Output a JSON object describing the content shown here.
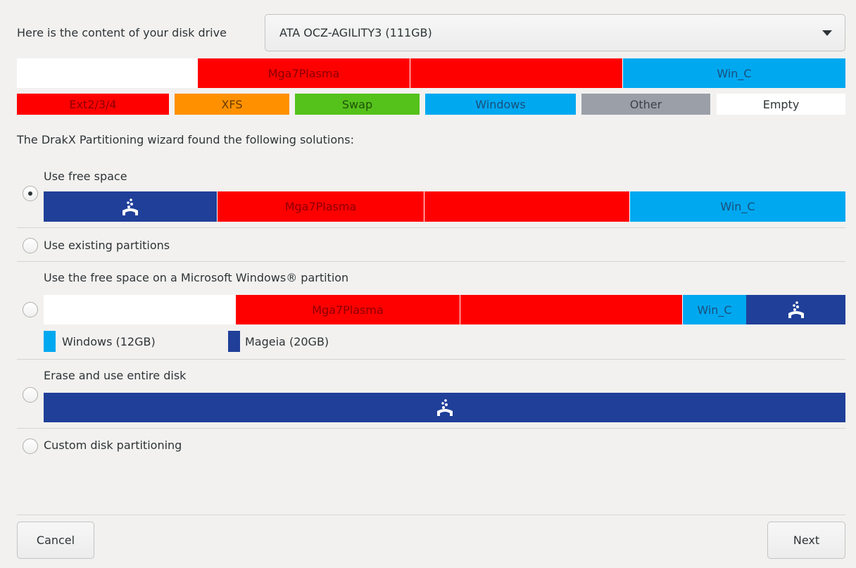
{
  "drive": {
    "label": "Here is the content of your disk drive",
    "selected": "ATA OCZ-AGILITY3 (111GB)"
  },
  "current_layout": {
    "segments": [
      {
        "type": "empty",
        "label": ""
      },
      {
        "type": "ext",
        "label": "Mga7Plasma"
      },
      {
        "type": "ext",
        "label": ""
      },
      {
        "type": "windows",
        "label": "Win_C"
      }
    ]
  },
  "legend": {
    "items": [
      "Ext2/3/4",
      "XFS",
      "Swap",
      "Windows",
      "Other",
      "Empty"
    ]
  },
  "wizard_message": "The DrakX Partitioning wizard found the following solutions:",
  "options": {
    "free_space": {
      "label": "Use free space",
      "selected": true,
      "segments": [
        {
          "type": "mageia",
          "label": ""
        },
        {
          "type": "ext",
          "label": "Mga7Plasma"
        },
        {
          "type": "ext",
          "label": ""
        },
        {
          "type": "windows",
          "label": "Win_C"
        }
      ]
    },
    "existing": {
      "label": "Use existing partitions",
      "selected": false
    },
    "windows_free": {
      "label": "Use the free space on a Microsoft Windows® partition",
      "selected": false,
      "segments": [
        {
          "type": "empty",
          "label": ""
        },
        {
          "type": "ext",
          "label": "Mga7Plasma"
        },
        {
          "type": "ext",
          "label": ""
        },
        {
          "type": "windows",
          "label": "Win_C"
        },
        {
          "type": "mageia",
          "label": ""
        }
      ],
      "legend_windows": "Windows (12GB)",
      "legend_mageia": "Mageia (20GB)"
    },
    "erase": {
      "label": "Erase and use entire disk",
      "selected": false
    },
    "custom": {
      "label": "Custom disk partitioning",
      "selected": false
    }
  },
  "buttons": {
    "cancel": "Cancel",
    "next": "Next"
  },
  "colors": {
    "ext": "#ff0000",
    "xfs": "#ff9100",
    "swap": "#55c11b",
    "windows": "#00a8f0",
    "other": "#9ba0a8",
    "empty": "#ffffff",
    "mageia": "#203f99"
  },
  "icons": {
    "mageia": "mageia-logo-icon",
    "dropdown": "chevron-down-icon"
  }
}
